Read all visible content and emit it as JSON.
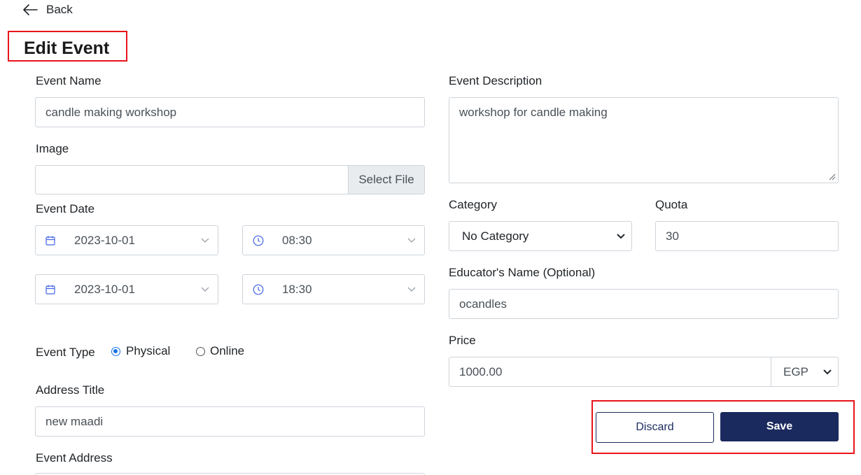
{
  "nav": {
    "back_label": "Back"
  },
  "page": {
    "title": "Edit Event"
  },
  "form": {
    "event_name": {
      "label": "Event Name",
      "value": "candle making workshop"
    },
    "image": {
      "label": "Image",
      "value": "",
      "button_label": "Select File"
    },
    "event_date": {
      "label": "Event Date",
      "start_date": "2023-10-01",
      "start_time": "08:30",
      "end_date": "2023-10-01",
      "end_time": "18:30"
    },
    "event_type": {
      "label": "Event Type",
      "options": [
        {
          "label": "Physical",
          "selected": true
        },
        {
          "label": "Online",
          "selected": false
        }
      ]
    },
    "address_title": {
      "label": "Address Title",
      "value": "new maadi"
    },
    "event_address": {
      "label": "Event Address"
    },
    "event_description": {
      "label": "Event Description",
      "value": "workshop for candle making"
    },
    "category": {
      "label": "Category",
      "value": "No Category"
    },
    "quota": {
      "label": "Quota",
      "value": "30"
    },
    "educator": {
      "label": "Educator's Name (Optional)",
      "value": "ocandles"
    },
    "price": {
      "label": "Price",
      "value": "1000.00",
      "currency": "EGP"
    }
  },
  "actions": {
    "discard_label": "Discard",
    "save_label": "Save"
  },
  "colors": {
    "primary": "#1b2a5e",
    "highlight": "#e8141b",
    "radio_accent": "#1a73e8"
  }
}
